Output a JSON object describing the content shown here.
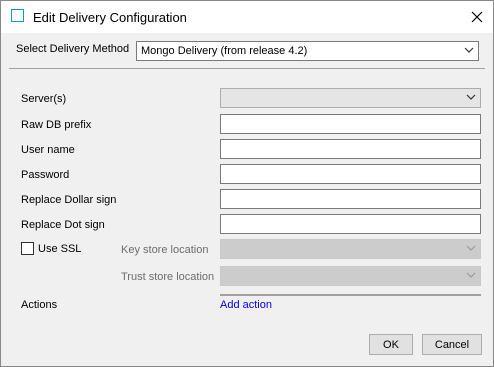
{
  "window": {
    "title": "Edit Delivery Configuration",
    "close_icon": "close-icon"
  },
  "method": {
    "label": "Select Delivery Method",
    "value": "Mongo Delivery (from release 4.2)"
  },
  "fields": {
    "servers": {
      "label": "Server(s)",
      "value": ""
    },
    "raw_db_prefix": {
      "label": "Raw DB prefix",
      "value": ""
    },
    "user_name": {
      "label": "User name",
      "value": ""
    },
    "password": {
      "label": "Password",
      "value": ""
    },
    "replace_dollar": {
      "label": "Replace Dollar sign",
      "value": ""
    },
    "replace_dot": {
      "label": "Replace Dot sign",
      "value": ""
    }
  },
  "ssl": {
    "label": "Use SSL",
    "checked": false
  },
  "key_store": {
    "label": "Key store location",
    "value": ""
  },
  "trust_store": {
    "label": "Trust store location",
    "value": ""
  },
  "actions": {
    "label": "Actions",
    "add_action": "Add action"
  },
  "buttons": {
    "ok": "OK",
    "cancel": "Cancel"
  }
}
